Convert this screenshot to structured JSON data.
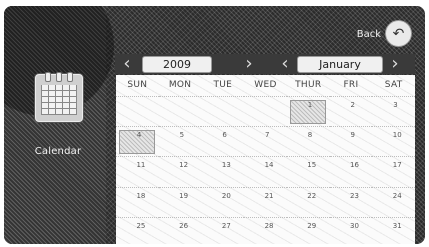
{
  "sidebar": {
    "app_icon": "calendar-icon",
    "app_label": "Calendar"
  },
  "header": {
    "back_label": "Back",
    "back_icon": "back-arrow-icon"
  },
  "navigation": {
    "year": "2009",
    "month": "January",
    "prev_year_glyph": "‹",
    "next_year_glyph": "›",
    "prev_month_glyph": "‹",
    "next_month_glyph": "›"
  },
  "calendar": {
    "weekdays": [
      "SUN",
      "MON",
      "TUE",
      "WED",
      "THUR",
      "FRI",
      "SAT"
    ],
    "weeks": [
      [
        "",
        "",
        "",
        "",
        "1",
        "2",
        "3"
      ],
      [
        "4",
        "5",
        "6",
        "7",
        "8",
        "9",
        "10"
      ],
      [
        "11",
        "12",
        "13",
        "14",
        "15",
        "16",
        "17"
      ],
      [
        "18",
        "19",
        "20",
        "21",
        "22",
        "23",
        "24"
      ],
      [
        "25",
        "26",
        "27",
        "28",
        "29",
        "30",
        "31"
      ]
    ],
    "highlighted_days": [
      "1",
      "4"
    ]
  }
}
